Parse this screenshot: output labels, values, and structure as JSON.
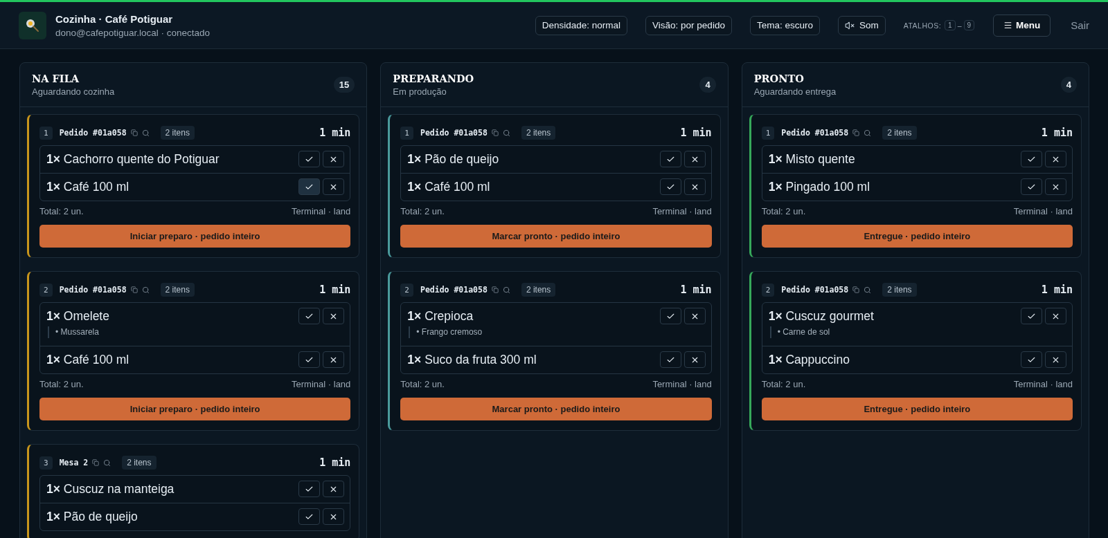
{
  "header": {
    "title": "Cozinha · Café Potiguar",
    "subtitle": "dono@cafepotiguar.local · conectado",
    "controls": [
      {
        "kind": "pill",
        "label": "Densidade: normal"
      },
      {
        "kind": "pill",
        "label": "Visão: por pedido"
      },
      {
        "kind": "pill",
        "label": "Tema: escuro"
      },
      {
        "kind": "sound",
        "label": "Som"
      }
    ],
    "shortcuts": {
      "label": "ATALHOS:",
      "from": "1",
      "separator": "–",
      "to": "9"
    },
    "menu": "Menu",
    "logout": "Sair"
  },
  "columns": [
    {
      "title": "NA FILA",
      "subtitle": "Aguardando cozinha",
      "count": "15",
      "color": "#c9961c",
      "orders": [
        {
          "index": "1",
          "title": "Pedido #01a058",
          "badge": "2 itens",
          "time": "1 min",
          "items": [
            {
              "text": "**1×** Cachorro quente do Potiguar",
              "done": false
            },
            {
              "text": "**1×** Café 100 ml",
              "done": true
            }
          ],
          "total": "Total: 2 un.",
          "source": "Terminal · land",
          "action": "Iniciar preparo · pedido inteiro"
        },
        {
          "index": "2",
          "title": "Pedido #01a058",
          "badge": "2 itens",
          "time": "1 min",
          "items": [
            {
              "text": "**1×** Omelete",
              "notes": [
                "• Mussarela"
              ],
              "done": false
            },
            {
              "text": "**1×** Café 100 ml",
              "done": false
            }
          ],
          "total": "Total: 2 un.",
          "source": "Terminal · land",
          "action": "Iniciar preparo · pedido inteiro"
        },
        {
          "index": "3",
          "title": "Mesa 2",
          "badge": "2 itens",
          "time": "1 min",
          "items": [
            {
              "text": "**1×** Cuscuz na manteiga",
              "done": false
            },
            {
              "text": "**1×** Pão de queijo",
              "done": false
            }
          ]
        }
      ]
    },
    {
      "title": "PREPARANDO",
      "subtitle": "Em produção",
      "count": "4",
      "color": "#4a9a9c",
      "orders": [
        {
          "index": "1",
          "title": "Pedido #01a058",
          "badge": "2 itens",
          "time": "1 min",
          "items": [
            {
              "text": "**1×** Pão de queijo",
              "done": false
            },
            {
              "text": "**1×** Café 100 ml",
              "done": false
            }
          ],
          "total": "Total: 2 un.",
          "source": "Terminal · land",
          "action": "Marcar pronto · pedido inteiro"
        },
        {
          "index": "2",
          "title": "Pedido #01a058",
          "badge": "2 itens",
          "time": "1 min",
          "items": [
            {
              "text": "**1×** Crepioca",
              "notes": [
                "• Frango cremoso"
              ],
              "done": false
            },
            {
              "text": "**1×** Suco da fruta 300 ml",
              "done": false
            }
          ],
          "total": "Total: 2 un.",
          "source": "Terminal · land",
          "action": "Marcar pronto · pedido inteiro"
        }
      ]
    },
    {
      "title": "PRONTO",
      "subtitle": "Aguardando entrega",
      "count": "4",
      "color": "#36a85a",
      "orders": [
        {
          "index": "1",
          "title": "Pedido #01a058",
          "badge": "2 itens",
          "time": "1 min",
          "items": [
            {
              "text": "**1×** Misto quente",
              "done": false
            },
            {
              "text": "**1×** Pingado 100 ml",
              "done": false
            }
          ],
          "total": "Total: 2 un.",
          "source": "Terminal · land",
          "action": "Entregue · pedido inteiro"
        },
        {
          "index": "2",
          "title": "Pedido #01a058",
          "badge": "2 itens",
          "time": "1 min",
          "items": [
            {
              "text": "**1×** Cuscuz gourmet",
              "notes": [
                "• Carne de sol"
              ],
              "done": false
            },
            {
              "text": "**1×** Cappuccino",
              "done": false
            }
          ],
          "total": "Total: 2 un.",
          "source": "Terminal · land",
          "action": "Entregue · pedido inteiro"
        }
      ]
    }
  ]
}
